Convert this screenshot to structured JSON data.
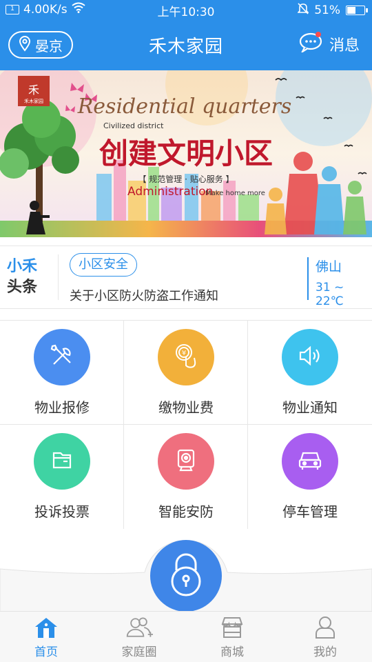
{
  "status_bar": {
    "speed": "4.00K/s",
    "time": "上午10:30",
    "battery": "51%",
    "battery_level": 0.51
  },
  "header": {
    "location": "晏京",
    "title": "禾木家园",
    "message_label": "消息"
  },
  "banner": {
    "logo_text": "禾木家园",
    "script_text": "Residential quarters",
    "subtitle": "Civilized district",
    "headline": "创建文明小区",
    "tagline": "【 规范管理 · 贴心服务 】",
    "admin_word": "Administration",
    "admin_suffix": "Make home more"
  },
  "news": {
    "logo_line1": "小禾",
    "logo_line2": "头条",
    "tag": "小区安全",
    "text": "关于小区防火防盗工作通知",
    "city": "佛山",
    "temperature": "31 ~ 22℃"
  },
  "services": [
    {
      "label": "物业报修",
      "icon": "wrench-screwdriver-icon",
      "color": "#4b8ef0"
    },
    {
      "label": "缴物业费",
      "icon": "coin-tap-icon",
      "color": "#f2b03a"
    },
    {
      "label": "物业通知",
      "icon": "speaker-icon",
      "color": "#3ec3ee"
    },
    {
      "label": "投诉投票",
      "icon": "folder-icon",
      "color": "#3fd3a3"
    },
    {
      "label": "智能安防",
      "icon": "camera-icon",
      "color": "#ef6f7e"
    },
    {
      "label": "停车管理",
      "icon": "car-icon",
      "color": "#a85ef0"
    }
  ],
  "tabs": [
    {
      "label": "首页",
      "icon": "home-icon",
      "active": true
    },
    {
      "label": "家庭圈",
      "icon": "family-icon",
      "active": false
    },
    {
      "label": "商城",
      "icon": "shop-icon",
      "active": false
    },
    {
      "label": "我的",
      "icon": "profile-icon",
      "active": false
    }
  ],
  "colors": {
    "primary": "#2b8fe9",
    "lock_button": "#3f86e8"
  }
}
